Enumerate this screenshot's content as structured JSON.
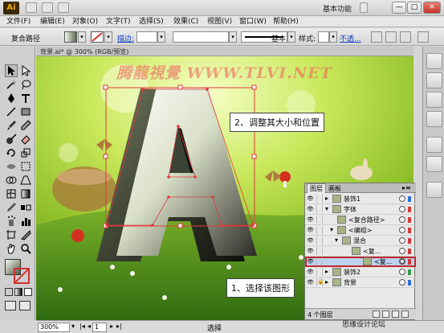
{
  "app": {
    "logo": "Ai",
    "workspace": "基本功能"
  },
  "window_buttons": [
    "—",
    "□",
    "✕"
  ],
  "menu": [
    "文件(F)",
    "编辑(E)",
    "对象(O)",
    "文字(T)",
    "选择(S)",
    "效果(C)",
    "视图(V)",
    "窗口(W)",
    "帮助(H)"
  ],
  "control": {
    "selection_label": "复合路径",
    "stroke_label": "描边:",
    "brush_label": "基本",
    "style_label": "样式:",
    "opacity_label": "不透...",
    "stroke_color": "#d13030"
  },
  "document": {
    "tab_title": "背景.ai* @ 300% (RGB/预览)"
  },
  "canvas": {
    "watermark": "腾龍視覺 WWW.TLVI.NET",
    "callout_adjust": "2、调整其大小和位置",
    "callout_select": "1、选择该图形",
    "selection_color": "#e03a3a"
  },
  "layers_panel": {
    "tabs": [
      "图层",
      "画板"
    ],
    "rows": [
      {
        "name": "装饰1",
        "color": "#2f6ee0",
        "selected": false
      },
      {
        "name": "字体",
        "color": "#d23a3a",
        "selected": false
      },
      {
        "name": "<复合路径>",
        "color": "#d23a3a",
        "selected": false
      },
      {
        "name": "<编组>",
        "color": "#d23a3a",
        "selected": false
      },
      {
        "name": "混合",
        "color": "#d23a3a",
        "selected": false
      },
      {
        "name": "<复...",
        "color": "#d23a3a",
        "selected": false
      },
      {
        "name": "<复...",
        "color": "#d23a3a",
        "selected": true
      },
      {
        "name": "装饰2",
        "color": "#2fa04a",
        "selected": false
      },
      {
        "name": "背景",
        "color": "#2f6ee0",
        "selected": false
      }
    ],
    "footer_count": "4 个图层"
  },
  "status": {
    "zoom": "300%",
    "page": "1",
    "tool": "选择"
  },
  "site_watermark": "思缘设计论坛"
}
